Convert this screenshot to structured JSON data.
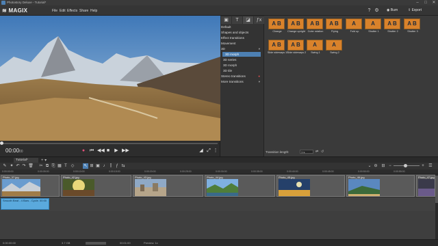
{
  "window": {
    "title": "Photostory Deluxe - Tutorial*",
    "minimize": "–",
    "maximize": "□",
    "close": "✕"
  },
  "menu": {
    "logo": "MAGIX",
    "items": [
      "File",
      "Edit",
      "Effects",
      "Share",
      "Help"
    ],
    "burn": "Burn",
    "export": "Export"
  },
  "preview": {
    "time": "00:00",
    "timeframes": "00"
  },
  "categories": {
    "tabs": [
      "▣",
      "T",
      "◪",
      "ƒx"
    ],
    "items": [
      {
        "label": "Default",
        "level": 0
      },
      {
        "label": "Shapes and objects",
        "level": 0
      },
      {
        "label": "Effect transitions",
        "level": 0
      },
      {
        "label": "Movement",
        "level": 0
      },
      {
        "label": "3D",
        "level": 0,
        "chev": "▾"
      },
      {
        "label": "3D morph",
        "level": 1,
        "selected": true
      },
      {
        "label": "3D series",
        "level": 1
      },
      {
        "label": "3D morph",
        "level": 1
      },
      {
        "label": "3D tile",
        "level": 1
      },
      {
        "label": "Stereo transitions",
        "level": 0
      },
      {
        "label": "More transitions",
        "level": 0,
        "chev": "▾"
      }
    ]
  },
  "effects": {
    "items": [
      {
        "label": "Change",
        "glyph": "A B"
      },
      {
        "label": "Change upright",
        "glyph": "A B"
      },
      {
        "label": "Cube rotation",
        "glyph": "A B"
      },
      {
        "label": "Flying",
        "glyph": "A B"
      },
      {
        "label": "Fold up",
        "glyph": "A"
      },
      {
        "label": "Shutter 1",
        "glyph": "A"
      },
      {
        "label": "Shutter 2",
        "glyph": "A B"
      },
      {
        "label": "Shutter 3",
        "glyph": "A B"
      },
      {
        "label": "Slide sideways 1",
        "glyph": "A B"
      },
      {
        "label": "Slide sideways 2",
        "glyph": "A B"
      },
      {
        "label": "Swing 1",
        "glyph": "A"
      },
      {
        "label": "Swing 2",
        "glyph": "A"
      }
    ],
    "transition_length_label": "Transition length:",
    "transition_length_value": "1 s"
  },
  "project": {
    "tab": "Tutorial*",
    "add": "+ ▾"
  },
  "ruler": {
    "ticks": [
      "0:00:00:00",
      "0:00:05:00",
      "0:00:10:00",
      "0:00:15:00",
      "0:00:20:00",
      "0:00:25:00",
      "0:00:30:00",
      "0:00:35:00",
      "0:00:40:00",
      "0:00:45:00",
      "0:00:50:00",
      "0:00:55:00"
    ]
  },
  "timeline": {
    "clips": [
      {
        "name": "Photo_37.jpg"
      },
      {
        "name": "Photo_42.jpg"
      },
      {
        "name": "Photo_43.jpg"
      },
      {
        "name": "Photo_44.jpg"
      },
      {
        "name": "Photo_45.jpg"
      },
      {
        "name": "Photo_46.jpg"
      },
      {
        "name": "Photo_47.jpg"
      }
    ],
    "audio_clip": "Smooth Beat - 4 Bars - Cycle.  00:00"
  },
  "status": {
    "left": "0:00:00:00",
    "mid1": "3.7 GB",
    "mid2": "00:01:00",
    "mid3": "Preview: 1x"
  }
}
